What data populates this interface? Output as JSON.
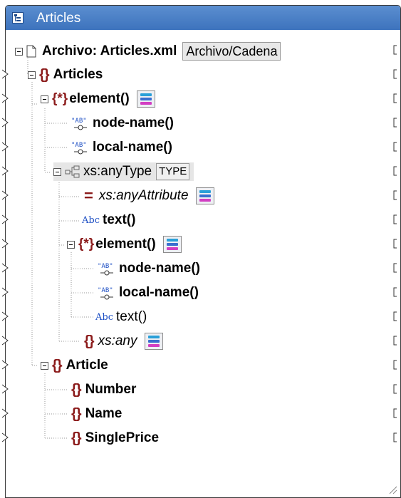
{
  "window": {
    "title": "Articles"
  },
  "root": {
    "label": "Archivo: Articles.xml",
    "mode_button": "Archivo/Cadena"
  },
  "tree": {
    "articles": "Articles",
    "element1": "element()",
    "node_name1": "node-name()",
    "local_name1": "local-name()",
    "anytype": "xs:anyType",
    "type_badge": "TYPE",
    "anyattribute": "xs:anyAttribute",
    "text1": "text()",
    "element2": "element()",
    "node_name2": "node-name()",
    "local_name2": "local-name()",
    "text2": "text()",
    "xsany": "xs:any",
    "article": "Article",
    "number": "Number",
    "name": "Name",
    "singleprice": "SinglePrice"
  },
  "icons": {
    "title": "structure-component-icon",
    "file": "file-icon",
    "element": "element-braces-icon",
    "wildcard": "wildcard-element-icon",
    "function": "xpath-function-icon",
    "text": "abc-text-icon",
    "attribute": "attribute-icon",
    "menu": "context-menu-icon"
  },
  "colors": {
    "titlebar": "#4a80c8",
    "element": "#8b1a1a",
    "text_icon": "#1d4fc4"
  }
}
